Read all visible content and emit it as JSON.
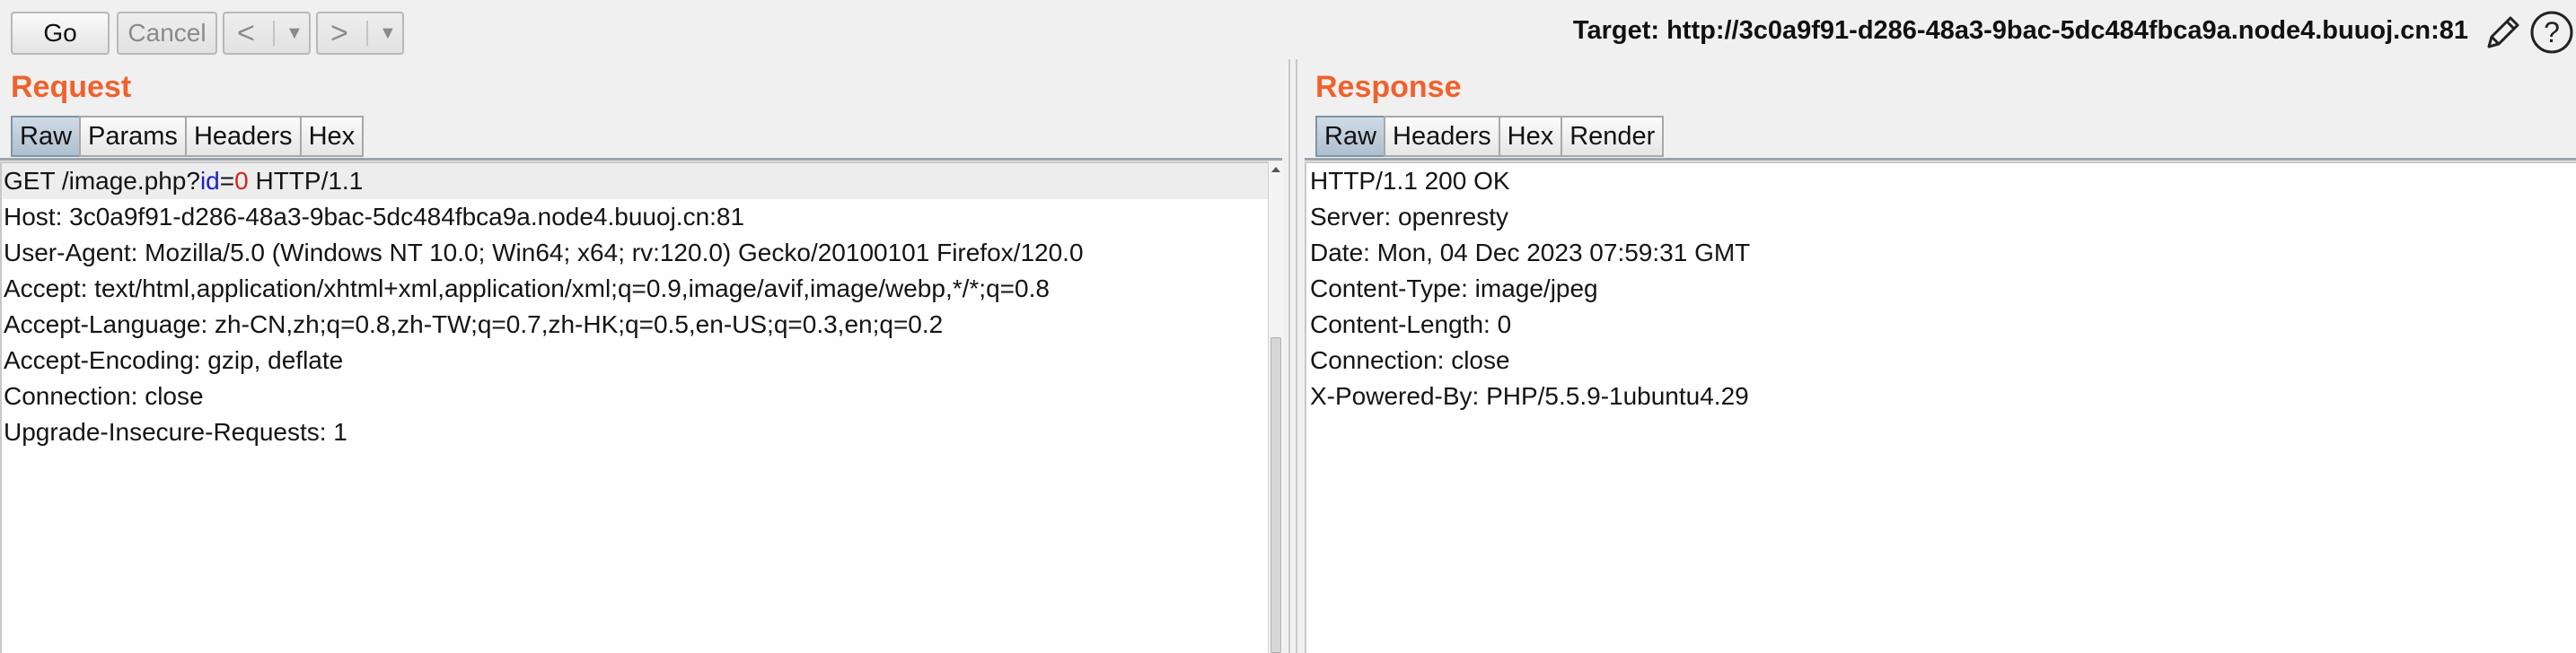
{
  "toolbar": {
    "go_label": "Go",
    "cancel_label": "Cancel",
    "back_label": "<",
    "forward_label": ">",
    "dropdown_glyph": "▼",
    "target_label": "Target: http://3c0a9f91-d286-48a3-9bac-5dc484fbca9a.node4.buuoj.cn:81",
    "edit_icon": "pencil-icon",
    "help_icon": "help-icon"
  },
  "request": {
    "title": "Request",
    "tabs": [
      {
        "label": "Raw",
        "active": true
      },
      {
        "label": "Params",
        "active": false
      },
      {
        "label": "Headers",
        "active": false
      },
      {
        "label": "Hex",
        "active": false
      }
    ],
    "first_line": {
      "method_path": "GET /image.php?",
      "param_name": "id",
      "eq": "=",
      "param_value": "0",
      "version": " HTTP/1.1"
    },
    "lines": [
      "Host: 3c0a9f91-d286-48a3-9bac-5dc484fbca9a.node4.buuoj.cn:81",
      "User-Agent: Mozilla/5.0 (Windows NT 10.0; Win64; x64; rv:120.0) Gecko/20100101 Firefox/120.0",
      "Accept: text/html,application/xhtml+xml,application/xml;q=0.9,image/avif,image/webp,*/*;q=0.8",
      "Accept-Language: zh-CN,zh;q=0.8,zh-TW;q=0.7,zh-HK;q=0.5,en-US;q=0.3,en;q=0.2",
      "Accept-Encoding: gzip, deflate",
      "Connection: close",
      "Upgrade-Insecure-Requests: 1"
    ]
  },
  "response": {
    "title": "Response",
    "tabs": [
      {
        "label": "Raw",
        "active": true
      },
      {
        "label": "Headers",
        "active": false
      },
      {
        "label": "Hex",
        "active": false
      },
      {
        "label": "Render",
        "active": false
      }
    ],
    "lines": [
      "HTTP/1.1 200 OK",
      "Server: openresty",
      "Date: Mon, 04 Dec 2023 07:59:31 GMT",
      "Content-Type: image/jpeg",
      "Content-Length: 0",
      "Connection: close",
      "X-Powered-By: PHP/5.5.9-1ubuntu4.29"
    ]
  },
  "colors": {
    "title_accent": "#f0622d",
    "param_name": "#1d21c9",
    "param_value": "#d0281a",
    "active_tab": "#b8c8d6"
  }
}
